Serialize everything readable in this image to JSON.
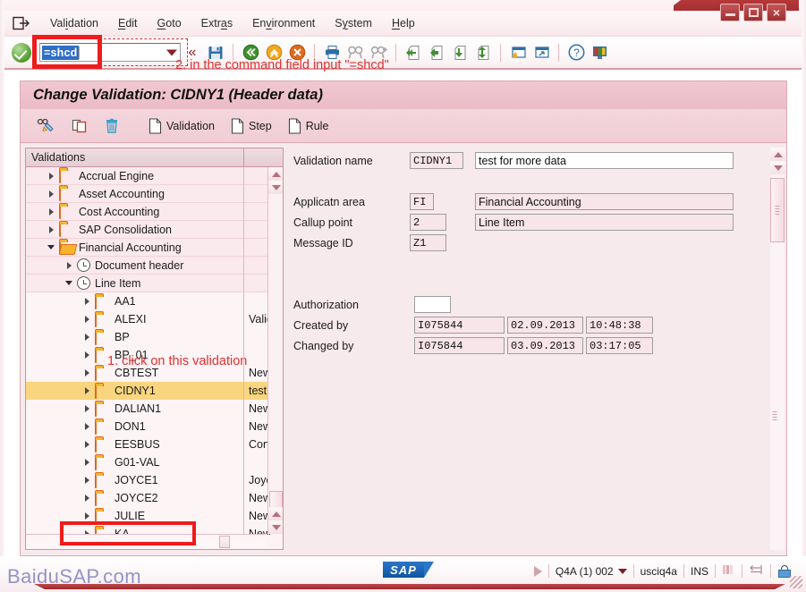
{
  "window": {
    "buttons": [
      {
        "name": "minimize",
        "glyph": "minimize-icon"
      },
      {
        "name": "maximize",
        "glyph": "maximize-icon"
      },
      {
        "name": "close",
        "glyph": "close-icon",
        "label": "×"
      }
    ]
  },
  "menubar": {
    "back_icon": "exit-icon",
    "items": [
      {
        "label": "Validation",
        "accel_index": 2
      },
      {
        "label": "Edit",
        "accel_index": 0
      },
      {
        "label": "Goto",
        "accel_index": 0
      },
      {
        "label": "Extras",
        "accel_index": 4
      },
      {
        "label": "Environment",
        "accel_index": 2
      },
      {
        "label": "System",
        "accel_index": 1
      },
      {
        "label": "Help",
        "accel_index": 0
      }
    ]
  },
  "toolbar": {
    "enter_icon": "green-checkmark-icon",
    "command_field": {
      "value": "=shcd",
      "placeholder": "",
      "dropdown_icon": "chevron-down-icon"
    },
    "collapse_icon": "double-chevron-left-icon",
    "icons": [
      "save-icon",
      "back-icon",
      "exit-icon",
      "cancel-icon",
      "print-icon",
      "find-icon",
      "find-next-icon",
      "first-page-icon",
      "previous-page-icon",
      "next-page-icon",
      "last-page-icon",
      "create-session-icon",
      "create-shortcut-icon",
      "help-icon",
      "customize-local-layout-icon"
    ]
  },
  "annotations": {
    "command": "2. in the command field input \"=shcd\"",
    "tree": "1. click on this validation"
  },
  "screen": {
    "title": "Change Validation: CIDNY1 (Header data)"
  },
  "app_toolbar": {
    "buttons": [
      {
        "label": "",
        "icon": "display-change-icon",
        "name": "display-change-button"
      },
      {
        "label": "",
        "icon": "copy-icon",
        "name": "copy-button"
      },
      {
        "label": "",
        "icon": "delete-icon",
        "name": "delete-button"
      },
      {
        "label": "Validation",
        "icon": "document-icon",
        "name": "validation-button"
      },
      {
        "label": "Step",
        "icon": "document-icon",
        "name": "step-button"
      },
      {
        "label": "Rule",
        "icon": "document-icon",
        "name": "rule-button"
      }
    ]
  },
  "tree": {
    "header": "Validations",
    "nodes": [
      {
        "label": "Accrual Engine",
        "desc": "",
        "level": 1,
        "icon": "folder",
        "expander": "right",
        "style": "top"
      },
      {
        "label": "Asset Accounting",
        "desc": "",
        "level": 1,
        "icon": "folder",
        "expander": "right",
        "style": "top"
      },
      {
        "label": "Cost Accounting",
        "desc": "",
        "level": 1,
        "icon": "folder",
        "expander": "right",
        "style": "top"
      },
      {
        "label": "SAP Consolidation",
        "desc": "",
        "level": 1,
        "icon": "folder",
        "expander": "right",
        "style": "top"
      },
      {
        "label": "Financial Accounting",
        "desc": "",
        "level": 1,
        "icon": "folder-open",
        "expander": "down",
        "style": "top"
      },
      {
        "label": "Document header",
        "desc": "",
        "level": 2,
        "icon": "clock",
        "expander": "right",
        "style": "mid"
      },
      {
        "label": "Line Item",
        "desc": "",
        "level": 2,
        "icon": "clock",
        "expander": "down",
        "style": "mid"
      },
      {
        "label": "AA1",
        "desc": "",
        "level": 3,
        "icon": "folder",
        "expander": "right",
        "style": "leaf"
      },
      {
        "label": "ALEXI",
        "desc": "Valid",
        "level": 3,
        "icon": "folder",
        "expander": "right",
        "style": "leaf"
      },
      {
        "label": "BP",
        "desc": "",
        "level": 3,
        "icon": "folder",
        "expander": "right",
        "style": "leaf"
      },
      {
        "label": "BP_01",
        "desc": "",
        "level": 3,
        "icon": "folder",
        "expander": "right",
        "style": "leaf"
      },
      {
        "label": "CBTEST",
        "desc": "New",
        "level": 3,
        "icon": "folder",
        "expander": "right",
        "style": "leaf"
      },
      {
        "label": "CIDNY1",
        "desc": "test f",
        "level": 3,
        "icon": "folder",
        "expander": "right",
        "style": "leaf",
        "selected": true
      },
      {
        "label": "DALIAN1",
        "desc": "New",
        "level": 3,
        "icon": "folder",
        "expander": "right",
        "style": "leaf"
      },
      {
        "label": "DON1",
        "desc": "New",
        "level": 3,
        "icon": "folder",
        "expander": "right",
        "style": "leaf"
      },
      {
        "label": "EESBUS",
        "desc": "Confi",
        "level": 3,
        "icon": "folder",
        "expander": "right",
        "style": "leaf"
      },
      {
        "label": "G01-VAL",
        "desc": "",
        "level": 3,
        "icon": "folder",
        "expander": "right",
        "style": "leaf"
      },
      {
        "label": "JOYCE1",
        "desc": "Joyce",
        "level": 3,
        "icon": "folder",
        "expander": "right",
        "style": "leaf"
      },
      {
        "label": "JOYCE2",
        "desc": "New",
        "level": 3,
        "icon": "folder",
        "expander": "right",
        "style": "leaf"
      },
      {
        "label": "JULIE",
        "desc": "New",
        "level": 3,
        "icon": "folder",
        "expander": "right",
        "style": "leaf"
      },
      {
        "label": "KA",
        "desc": "New",
        "level": 3,
        "icon": "folder",
        "expander": "right",
        "style": "leaf"
      }
    ]
  },
  "form": {
    "validation_name_label": "Validation name",
    "validation_name_key": "CIDNY1",
    "validation_name_text": "test for more data",
    "application_area_label": "Applicatn area",
    "application_area_key": "FI",
    "application_area_text": "Financial Accounting",
    "callup_point_label": "Callup point",
    "callup_point_key": "2",
    "callup_point_text": "Line Item",
    "message_id_label": "Message ID",
    "message_id_key": "Z1",
    "authorization_label": "Authorization",
    "authorization_value": "",
    "created_by_label": "Created by",
    "created_by_user": "I075844",
    "created_by_date": "02.09.2013",
    "created_by_time": "10:48:38",
    "changed_by_label": "Changed by",
    "changed_by_user": "I075844",
    "changed_by_date": "03.09.2013",
    "changed_by_time": "03:17:05"
  },
  "statusbar": {
    "logo": "SAP",
    "system": "Q4A (1) 002",
    "server": "usciq4a",
    "insert_mode": "INS",
    "play_icon": "ready-icon",
    "dropdown_icon": "chevron-down-icon",
    "data_icon": "data-transfer-icon",
    "response_icon": "response-time-icon",
    "lock_icon": "unlocked-icon"
  },
  "watermark": "BaiduSAP.com",
  "colors": {
    "accent_red": "#8d2224",
    "selection_gold": "#fad57f",
    "annotation_red": "#e03030",
    "header_pink": "#eec1cc",
    "panel_pink": "#f7eaed",
    "folder_yellow": "#f7b42c",
    "command_selection_blue": "#2e6ec9"
  }
}
